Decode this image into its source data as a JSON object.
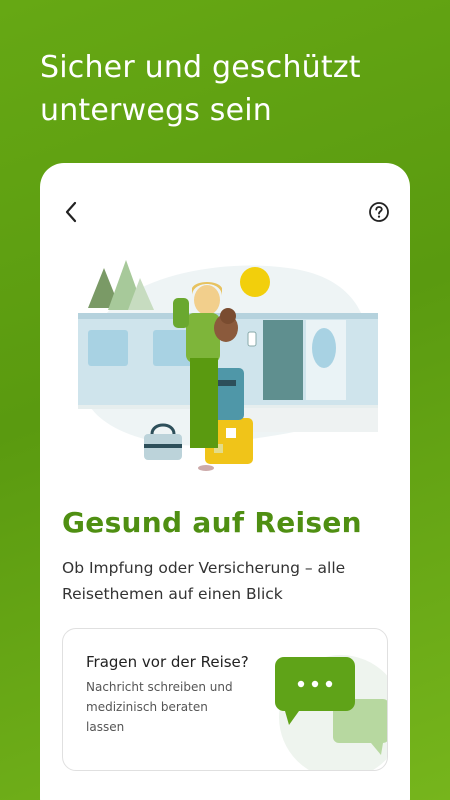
{
  "header": {
    "headline": "Sicher und geschützt unterwegs sein"
  },
  "card": {
    "title": "Gesund auf Reisen",
    "description": "Ob Impfung oder Versicherung – alle Reisethemen auf einen Blick"
  },
  "chat_card": {
    "title": "Fragen vor der Reise?",
    "subtitle": "Nachricht schreiben und medizinisch beraten lassen"
  },
  "icons": {
    "back": "chevron-left-icon",
    "help": "question-circle-icon",
    "chat": "chat-bubbles-icon"
  },
  "colors": {
    "brand_green": "#5a9a10",
    "title_green": "#4f8f12",
    "chat_bubble": "#5fa318",
    "chat_bubble_light": "#b7d8a0"
  }
}
